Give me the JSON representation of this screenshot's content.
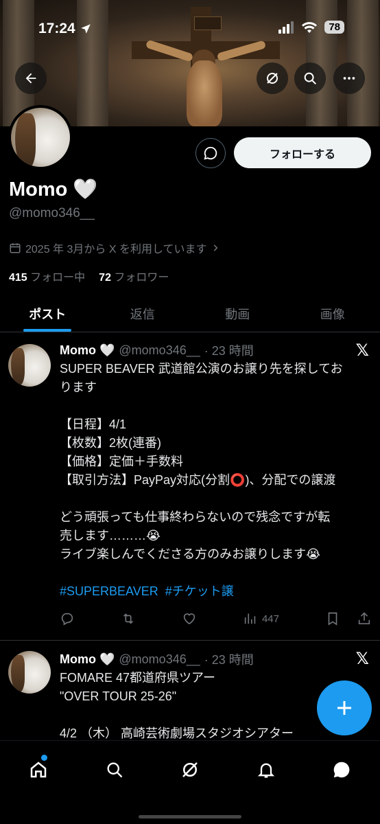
{
  "status": {
    "time": "17:24",
    "battery": "78"
  },
  "profile": {
    "name": "Momo 🤍",
    "handle": "@momo346__",
    "joined": "2025 年 3月から X を利用しています",
    "following_count": "415",
    "following_label": "フォロー中",
    "followers_count": "72",
    "followers_label": "フォロワー",
    "follow_button": "フォローする"
  },
  "tabs": [
    {
      "label": "ポスト",
      "active": true
    },
    {
      "label": "返信"
    },
    {
      "label": "動画"
    },
    {
      "label": "画像"
    }
  ],
  "posts": [
    {
      "name": "Momo 🤍",
      "handle": "@momo346__",
      "time": "· 23 時間",
      "lines": [
        "SUPER BEAVER 武道館公演のお譲り先を探してお",
        "ります",
        "",
        "【日程】4/1",
        "【枚数】2枚(連番)",
        "【価格】定価＋手数料",
        "【取引方法】PayPay対応(分割⭕️)、分配での譲渡",
        "",
        "どう頑張っても仕事終わらないので残念ですが転",
        "売します………😭",
        "ライブ楽しんでくださる方のみお譲りします😭",
        ""
      ],
      "hashtags": "#SUPERBEAVER  #チケット譲",
      "views": "447"
    },
    {
      "name": "Momo 🤍",
      "handle": "@momo346__",
      "time": "· 23 時間",
      "lines": [
        "FOMARE 47都道府県ツアー",
        "\"OVER TOUR 25-26\"",
        "",
        "4/2 （木） 高崎芸術劇場スタジオシアター"
      ]
    }
  ],
  "colors": {
    "accent": "#1d9bf0",
    "muted": "#71767b",
    "background": "#000000"
  },
  "icons": [
    "back-arrow-icon",
    "grok-icon",
    "search-icon",
    "more-icon",
    "message-icon",
    "calendar-icon",
    "reply-icon",
    "retweet-icon",
    "like-icon",
    "views-icon",
    "bookmark-icon",
    "share-icon",
    "x-logo-icon",
    "compose-plus-icon",
    "home-icon",
    "explore-icon",
    "grok-nav-icon",
    "notifications-icon",
    "messages-icon"
  ]
}
